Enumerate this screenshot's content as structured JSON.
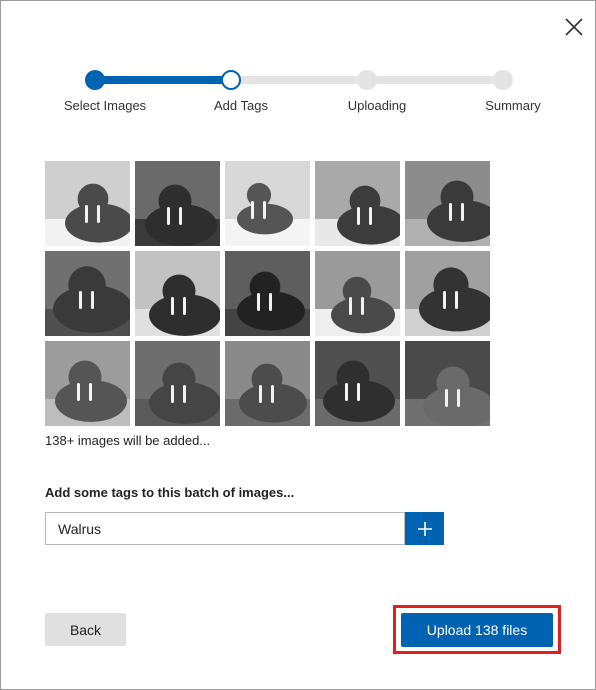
{
  "stepper": {
    "steps": [
      {
        "label": "Select Images",
        "state": "done"
      },
      {
        "label": "Add Tags",
        "state": "current"
      },
      {
        "label": "Uploading",
        "state": "todo"
      },
      {
        "label": "Summary",
        "state": "todo"
      }
    ]
  },
  "gallery": {
    "thumbnails": [
      "walrus-photo",
      "walrus-photo",
      "walrus-photo",
      "walrus-photo",
      "walrus-photo",
      "walrus-photo",
      "walrus-photo",
      "walrus-photo",
      "walrus-photo",
      "walrus-photo",
      "walrus-photo",
      "walrus-photo",
      "walrus-photo",
      "walrus-photo",
      "walrus-photo"
    ],
    "count_text": "138+ images will be added..."
  },
  "tags": {
    "heading": "Add some tags to this batch of images...",
    "input_value": "Walrus",
    "add_icon": "plus-icon"
  },
  "actions": {
    "back_label": "Back",
    "upload_label": "Upload 138 files"
  },
  "colors": {
    "accent": "#0063b1",
    "highlight": "#e02020"
  }
}
